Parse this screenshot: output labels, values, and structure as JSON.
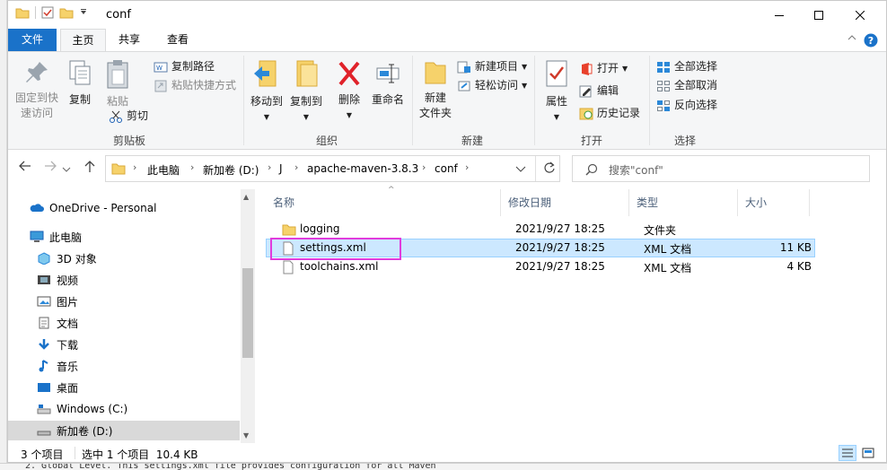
{
  "window": {
    "title": "conf"
  },
  "tabs": [
    "文件",
    "主页",
    "共享",
    "查看"
  ],
  "ribbon": {
    "clipboard": {
      "pin_label": "固定到快\n速访问",
      "copy_label": "复制",
      "paste_label": "粘贴",
      "copy_path_label": "复制路径",
      "paste_shortcut_label": "粘贴快捷方式",
      "cut_label": "剪切",
      "group_label": "剪贴板"
    },
    "organize": {
      "move_to_label": "移动到",
      "copy_to_label": "复制到",
      "delete_label": "删除",
      "rename_label": "重命名",
      "group_label": "组织"
    },
    "new": {
      "new_folder_label": "新建\n文件夹",
      "new_item_label": "新建项目",
      "easy_access_label": "轻松访问",
      "group_label": "新建"
    },
    "open": {
      "properties_label": "属性",
      "open_label": "打开",
      "edit_label": "编辑",
      "history_label": "历史记录",
      "group_label": "打开"
    },
    "select": {
      "select_all_label": "全部选择",
      "select_none_label": "全部取消",
      "invert_label": "反向选择",
      "group_label": "选择"
    }
  },
  "address": {
    "crumbs": [
      "此电脑",
      "新加卷 (D:)",
      "J",
      "apache-maven-3.8.3",
      "conf"
    ],
    "search_placeholder": "搜索\"conf\""
  },
  "nav": {
    "items": [
      {
        "label": "OneDrive - Personal",
        "icon": "cloud-icon"
      },
      {
        "label": "此电脑",
        "icon": "computer-icon"
      },
      {
        "label": "3D 对象",
        "icon": "cube-icon"
      },
      {
        "label": "视频",
        "icon": "video-icon"
      },
      {
        "label": "图片",
        "icon": "picture-icon"
      },
      {
        "label": "文档",
        "icon": "document-icon"
      },
      {
        "label": "下载",
        "icon": "download-icon"
      },
      {
        "label": "音乐",
        "icon": "music-icon"
      },
      {
        "label": "桌面",
        "icon": "desktop-icon"
      },
      {
        "label": "Windows (C:)",
        "icon": "drive-icon"
      },
      {
        "label": "新加卷 (D:)",
        "icon": "drive-icon"
      }
    ]
  },
  "columns": {
    "name": "名称",
    "date": "修改日期",
    "type": "类型",
    "size": "大小"
  },
  "files": [
    {
      "name": "logging",
      "date": "2021/9/27 18:25",
      "type": "文件夹",
      "size": "",
      "icon": "folder-icon"
    },
    {
      "name": "settings.xml",
      "date": "2021/9/27 18:25",
      "type": "XML 文档",
      "size": "11 KB",
      "icon": "file-icon"
    },
    {
      "name": "toolchains.xml",
      "date": "2021/9/27 18:25",
      "type": "XML 文档",
      "size": "4 KB",
      "icon": "file-icon"
    }
  ],
  "status": {
    "count": "3 个项目",
    "selected": "选中 1 个项目  10.4 KB"
  },
  "background_text": "2. Global Level. This settings.xml file provides configuration for all Maven",
  "colors": {
    "accent": "#1a72c9",
    "selection": "#cce8ff",
    "highlight_box": "#e13bdc"
  }
}
